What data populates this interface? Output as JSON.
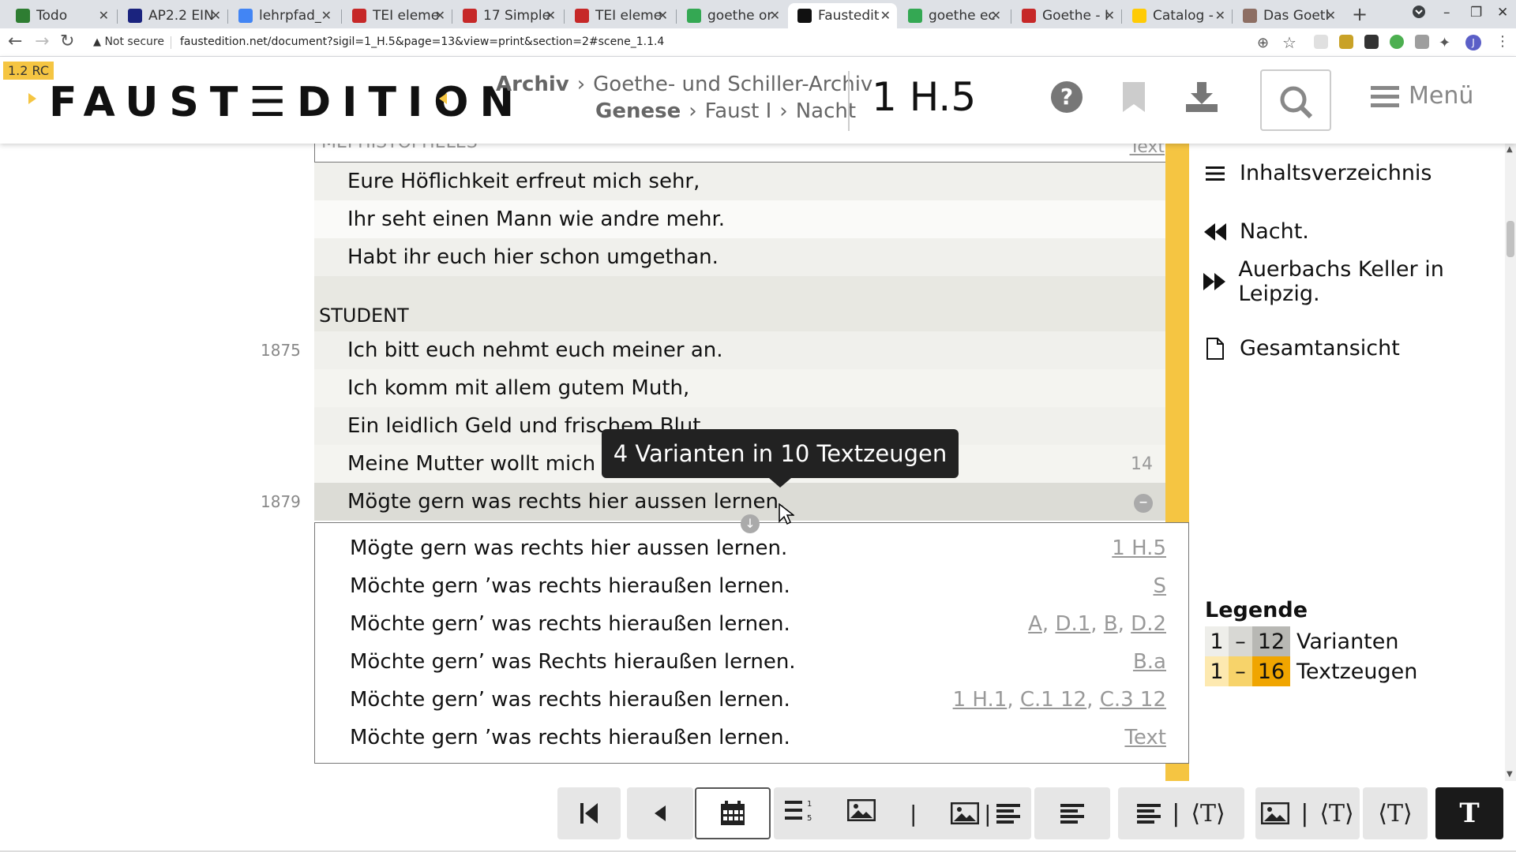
{
  "browser": {
    "tabs": [
      {
        "title": "Todo",
        "icon": "checkbox-favicon",
        "color": "#2e7d32"
      },
      {
        "title": "AP2.2 EIN",
        "icon": "star-favicon",
        "color": "#1a237e"
      },
      {
        "title": "lehrpfad_",
        "icon": "docs-favicon",
        "color": "#4285f4"
      },
      {
        "title": "TEI eleme",
        "icon": "tei-favicon",
        "color": "#c62828"
      },
      {
        "title": "17 Simple",
        "icon": "tei-favicon",
        "color": "#c62828"
      },
      {
        "title": "TEI eleme",
        "icon": "tei-favicon",
        "color": "#c62828"
      },
      {
        "title": "goethe or",
        "icon": "google-favicon",
        "color": "#34a853"
      },
      {
        "title": "Faustedit",
        "icon": "faust-favicon",
        "color": "#111111"
      },
      {
        "title": "goethe ec",
        "icon": "google-favicon",
        "color": "#34a853"
      },
      {
        "title": "Goethe - I",
        "icon": "r-favicon",
        "color": "#c62828"
      },
      {
        "title": "Catalog -",
        "icon": "m-favicon",
        "color": "#ffcb05"
      },
      {
        "title": "Das Goetl",
        "icon": "portrait-favicon",
        "color": "#8d6e63"
      }
    ],
    "active_tab": 7,
    "security": "Not secure",
    "url": "faustedition.net/document?sigil=1_H.5&page=13&view=print&section=2#scene_1.1.4",
    "profile_initial": "J"
  },
  "header": {
    "version": "1.2 RC",
    "logo": "FAUST☰DITION",
    "breadcrumb1": {
      "strong": "Archiv",
      "items": [
        "Goethe- und Schiller-Archiv"
      ]
    },
    "breadcrumb2": {
      "strong": "Genese",
      "items": [
        "Faust I",
        "Nacht"
      ]
    },
    "sigil": "1 H.5",
    "menu_label": "Menü"
  },
  "text": {
    "speaker_top_cut": "MEPHISTOPHELES",
    "top_cut_ref": "Text",
    "lines_a": [
      "Eure Höflichkeit erfreut mich sehr,",
      "Ihr seht einen Mann wie andre mehr.",
      "Habt ihr euch hier schon umgethan."
    ],
    "speaker": "STUDENT",
    "lines_b": [
      {
        "num": "1875",
        "text": "Ich bitt euch nehmt euch meiner an."
      },
      {
        "num": "",
        "text": "Ich komm mit allem gutem Muth,"
      },
      {
        "num": "",
        "text": "Ein leidlich Geld und frischem Blut"
      },
      {
        "num": "",
        "text": "Meine Mutter wollt mich kaum entfernen;",
        "badge": "14"
      },
      {
        "num": "1879",
        "text": "Mögte gern was rechts hier aussen lernen."
      }
    ],
    "tooltip": "4 Varianten in 10 Textzeugen",
    "variants": [
      {
        "text": "Mögte gern was rechts hier aussen lernen.",
        "sigils": [
          "1 H.5"
        ]
      },
      {
        "text": "Möchte gern ’was rechts hieraußen lernen.",
        "sigils": [
          "S"
        ]
      },
      {
        "text": "Möchte gern’ was rechts hieraußen lernen.",
        "sigils": [
          "A",
          "D.1",
          "B",
          "D.2"
        ]
      },
      {
        "text": "Möchte gern’ was Rechts hieraußen lernen.",
        "sigils": [
          "B.a"
        ]
      },
      {
        "text": "Möchte gern’ was rechts hieraußen lernen.",
        "sigils": [
          "1 H.1",
          "C.1 12",
          "C.3 12"
        ]
      },
      {
        "text": "Möchte gern ’was rechts hieraußen lernen.",
        "sigils": [
          "Text"
        ]
      }
    ]
  },
  "sidebar": {
    "toc": "Inhaltsverzeichnis",
    "prev": "Nacht.",
    "next": "Auerbachs Keller in Leipzig.",
    "overview": "Gesamtansicht",
    "legend_title": "Legende",
    "legend": [
      {
        "from": "1",
        "dash": "–",
        "to": "12",
        "label": "Varianten"
      },
      {
        "from": "1",
        "dash": "–",
        "to": "16",
        "label": "Textzeugen"
      }
    ]
  },
  "toolbar": {
    "buttons": [
      "first-page",
      "prev-page",
      "calendar-view",
      "line-numbers-view",
      "image-view",
      "image-text-view",
      "text-align-view",
      "text-diplomatic-view",
      "image-diplomatic-view",
      "diplomatic-view",
      "print-text-view"
    ]
  },
  "colors": {
    "accent": "#f5c542",
    "accent_dark": "#f0a500",
    "grey_row": "#e8e8e2",
    "light_row": "#f0f0ec"
  }
}
